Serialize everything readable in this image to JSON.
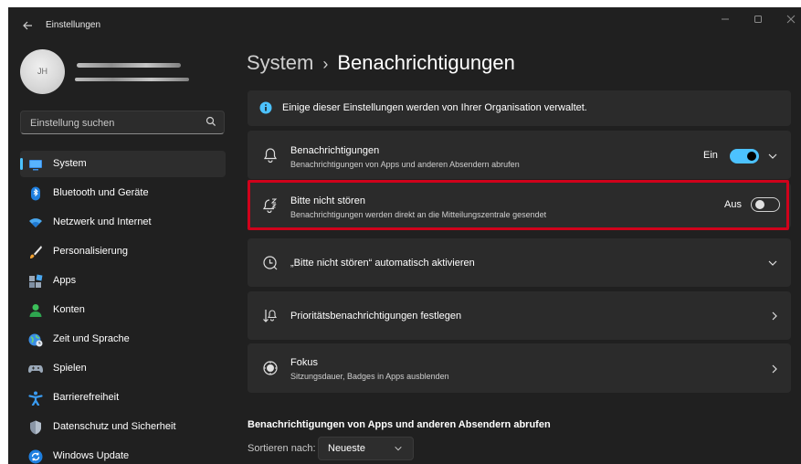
{
  "window": {
    "title": "Einstellungen"
  },
  "user": {
    "initials": "JH"
  },
  "search": {
    "placeholder": "Einstellung suchen"
  },
  "sidebar": {
    "items": [
      {
        "label": "System",
        "icon": "system-icon",
        "active": true
      },
      {
        "label": "Bluetooth und Geräte",
        "icon": "bluetooth-icon"
      },
      {
        "label": "Netzwerk und Internet",
        "icon": "wifi-icon"
      },
      {
        "label": "Personalisierung",
        "icon": "brush-icon"
      },
      {
        "label": "Apps",
        "icon": "apps-icon"
      },
      {
        "label": "Konten",
        "icon": "account-icon"
      },
      {
        "label": "Zeit und Sprache",
        "icon": "globe-clock-icon"
      },
      {
        "label": "Spielen",
        "icon": "gamepad-icon"
      },
      {
        "label": "Barrierefreiheit",
        "icon": "accessibility-icon"
      },
      {
        "label": "Datenschutz und Sicherheit",
        "icon": "shield-icon"
      },
      {
        "label": "Windows Update",
        "icon": "update-icon"
      }
    ]
  },
  "header": {
    "breadcrumb_parent": "System",
    "breadcrumb_separator": "›",
    "title": "Benachrichtigungen"
  },
  "info_banner": {
    "text": "Einige dieser Einstellungen werden von Ihrer Organisation verwaltet."
  },
  "settings": {
    "notifications": {
      "title": "Benachrichtigungen",
      "subtitle": "Benachrichtigungen von Apps und anderen Absendern abrufen",
      "state_label": "Ein",
      "on": true
    },
    "dnd": {
      "title": "Bitte nicht stören",
      "subtitle": "Benachrichtigungen werden direkt an die Mitteilungszentrale gesendet",
      "state_label": "Aus",
      "on": false
    },
    "dnd_auto": {
      "title": "„Bitte nicht stören“ automatisch aktivieren"
    },
    "priority": {
      "title": "Prioritätsbenachrichtigungen festlegen"
    },
    "focus": {
      "title": "Fokus",
      "subtitle": "Sitzungsdauer, Badges in Apps ausblenden"
    }
  },
  "apps_section": {
    "title": "Benachrichtigungen von Apps und anderen Absendern abrufen",
    "sort_label": "Sortieren nach:",
    "sort_value": "Neueste"
  },
  "colors": {
    "accent": "#4cc2ff",
    "highlight": "#d0021b",
    "background": "#202020",
    "card": "#2b2b2b"
  }
}
